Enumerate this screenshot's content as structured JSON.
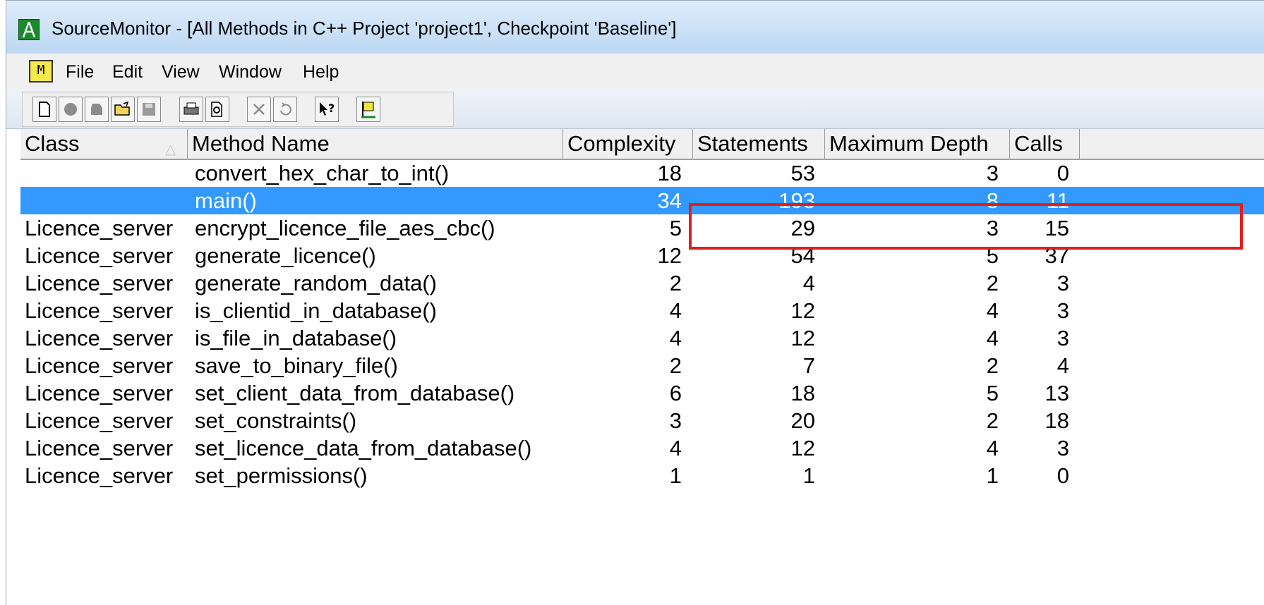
{
  "window": {
    "title": "SourceMonitor - [All Methods in C++ Project 'project1', Checkpoint 'Baseline']"
  },
  "menu": [
    {
      "label": "File"
    },
    {
      "label": "Edit"
    },
    {
      "label": "View"
    },
    {
      "label": "Window"
    },
    {
      "label": "Help"
    }
  ],
  "toolbar": {
    "buttons": [
      {
        "icon": "new-file-icon"
      },
      {
        "icon": "record-icon"
      },
      {
        "icon": "shape-icon"
      },
      {
        "icon": "open-folder-icon"
      },
      {
        "icon": "save-icon"
      },
      {
        "icon": "print-icon"
      },
      {
        "icon": "print-preview-icon"
      },
      {
        "icon": "delete-icon"
      },
      {
        "icon": "refresh-icon"
      },
      {
        "icon": "context-help-icon"
      },
      {
        "icon": "flag-icon"
      }
    ],
    "doc_icon_letter": "M"
  },
  "table": {
    "columns": [
      {
        "label": "Class"
      },
      {
        "label": "Method Name"
      },
      {
        "label": "Complexity"
      },
      {
        "label": "Statements"
      },
      {
        "label": "Maximum Depth"
      },
      {
        "label": "Calls"
      }
    ],
    "sorted_column": "Class",
    "selection_color": "#3399ff",
    "highlight_color": "#e81b1b",
    "rows": [
      {
        "class": "",
        "method": "convert_hex_char_to_int()",
        "complexity": "18",
        "statements": "53",
        "depth": "3",
        "calls": "0"
      },
      {
        "class": "",
        "method": "main()",
        "complexity": "34",
        "statements": "193",
        "depth": "8",
        "calls": "11"
      },
      {
        "class": "Licence_server",
        "method": "encrypt_licence_file_aes_cbc()",
        "complexity": "5",
        "statements": "29",
        "depth": "3",
        "calls": "15"
      },
      {
        "class": "Licence_server",
        "method": "generate_licence()",
        "complexity": "12",
        "statements": "54",
        "depth": "5",
        "calls": "37"
      },
      {
        "class": "Licence_server",
        "method": "generate_random_data()",
        "complexity": "2",
        "statements": "4",
        "depth": "2",
        "calls": "3"
      },
      {
        "class": "Licence_server",
        "method": "is_clientid_in_database()",
        "complexity": "4",
        "statements": "12",
        "depth": "4",
        "calls": "3"
      },
      {
        "class": "Licence_server",
        "method": "is_file_in_database()",
        "complexity": "4",
        "statements": "12",
        "depth": "4",
        "calls": "3"
      },
      {
        "class": "Licence_server",
        "method": "save_to_binary_file()",
        "complexity": "2",
        "statements": "7",
        "depth": "2",
        "calls": "4"
      },
      {
        "class": "Licence_server",
        "method": "set_client_data_from_database()",
        "complexity": "6",
        "statements": "18",
        "depth": "5",
        "calls": "13"
      },
      {
        "class": "Licence_server",
        "method": "set_constraints()",
        "complexity": "3",
        "statements": "20",
        "depth": "2",
        "calls": "18"
      },
      {
        "class": "Licence_server",
        "method": "set_licence_data_from_database()",
        "complexity": "4",
        "statements": "12",
        "depth": "4",
        "calls": "3"
      },
      {
        "class": "Licence_server",
        "method": "set_permissions()",
        "complexity": "1",
        "statements": "1",
        "depth": "1",
        "calls": "0"
      }
    ]
  }
}
